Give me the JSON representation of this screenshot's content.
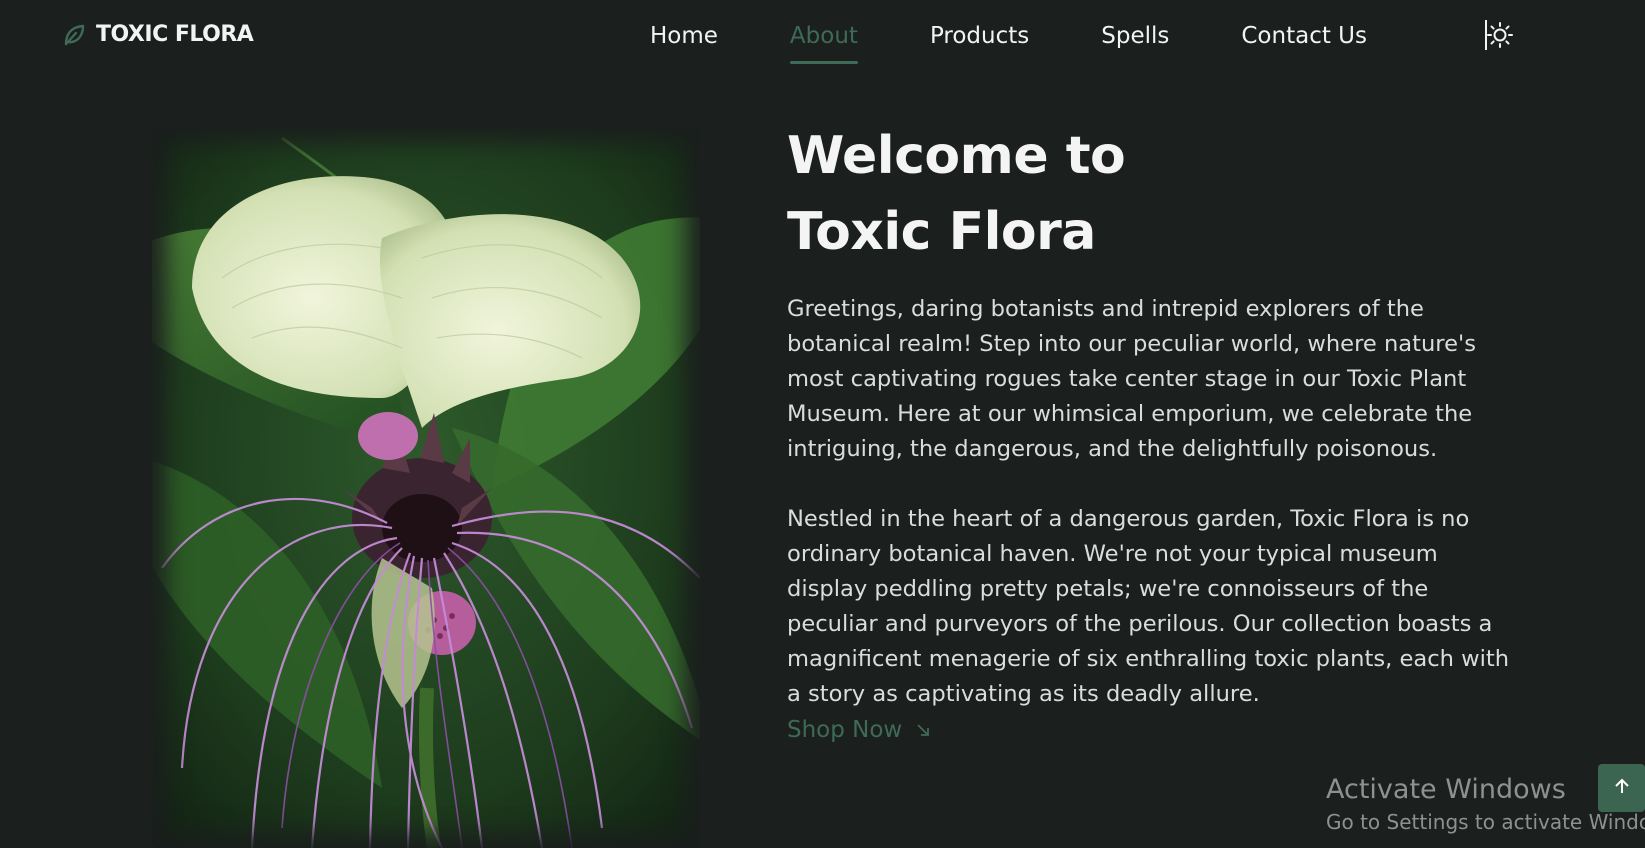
{
  "brand": {
    "name": "TOXIC FLORA",
    "icon": "leaf-icon",
    "accent": "#3f6b56"
  },
  "nav": {
    "items": [
      {
        "label": "Home",
        "active": false
      },
      {
        "label": "About",
        "active": true
      },
      {
        "label": "Products",
        "active": false
      },
      {
        "label": "Spells",
        "active": false
      },
      {
        "label": "Contact Us",
        "active": false
      }
    ],
    "theme_toggle_icon": "sun-icon"
  },
  "hero": {
    "image_alt": "bat-flower-image",
    "title_line1": "Welcome to",
    "title_line2": "Toxic Flora",
    "paragraph1": "Greetings, daring botanists and intrepid explorers of the botanical realm! Step into our peculiar world, where nature's most captivating rogues take center stage in our Toxic Plant Museum. Here at our whimsical emporium, we celebrate the intriguing, the dangerous, and the delightfully poisonous.",
    "paragraph2": "Nestled in the heart of a dangerous garden, Toxic Flora is no ordinary botanical haven. We're not your typical museum display peddling pretty petals; we're connoisseurs of the peculiar and purveyors of the perilous. Our collection boasts a magnificent menagerie of six enthralling toxic plants, each with a story as captivating as its deadly allure.",
    "cta_label": "Shop Now",
    "cta_icon": "arrow-down-right-icon"
  },
  "watermark": {
    "title": "Activate Windows",
    "subtitle": "Go to Settings to activate Windows."
  },
  "scroll_top_icon": "arrow-up-icon",
  "colors": {
    "background": "#1b1f1e",
    "text": "#f2f4f3",
    "accent": "#3f6b56"
  }
}
